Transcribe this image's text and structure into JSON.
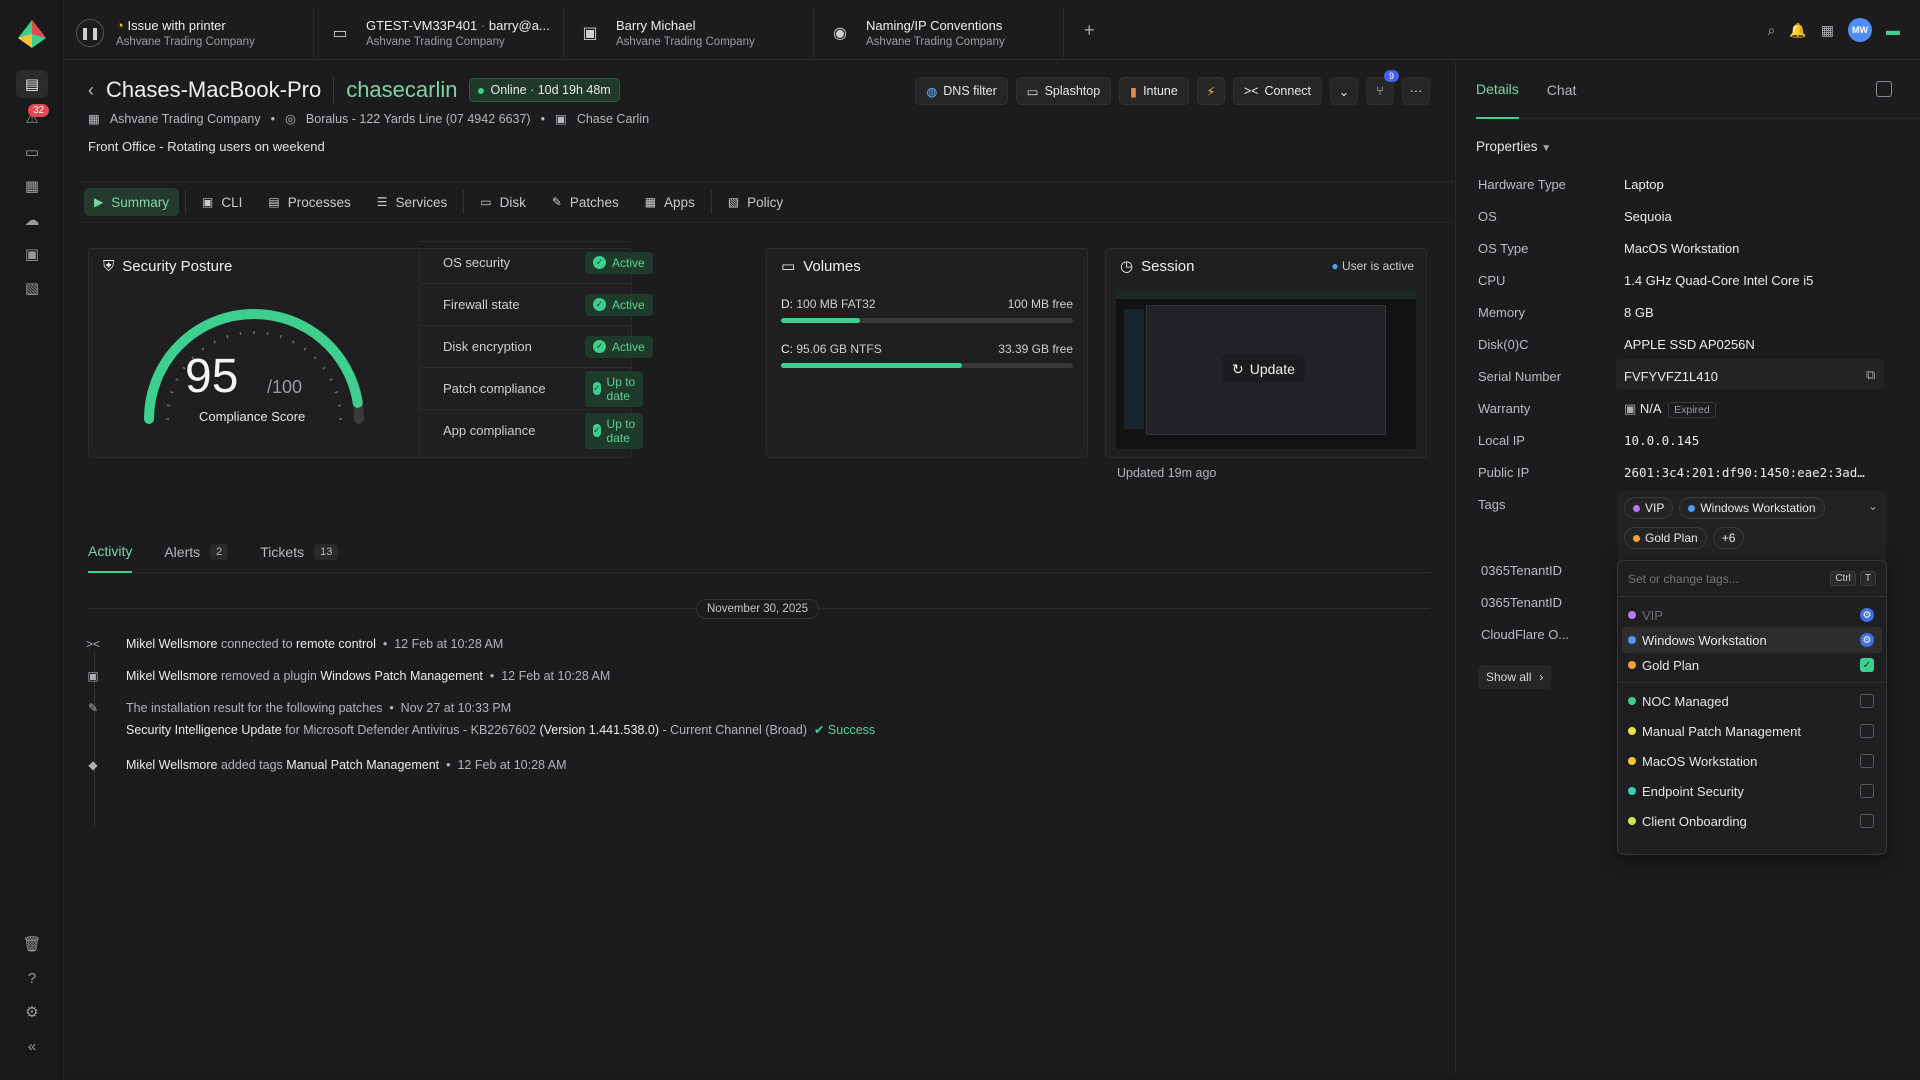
{
  "rail": {
    "badge": "32"
  },
  "top_tabs": [
    {
      "title": "Issue with printer",
      "sub": "Ashvane Trading Company"
    },
    {
      "title": "GTEST-VM33P401",
      "title2": "barry@a...",
      "sub": "Ashvane Trading Company"
    },
    {
      "title": "Barry Michael",
      "sub": "Ashvane Trading Company"
    },
    {
      "title": "Naming/IP Conventions",
      "sub": "Ashvane Trading Company"
    }
  ],
  "avatar_initials": "MW",
  "device": {
    "name": "Chases-MacBook-Pro",
    "user": "chasecarlin",
    "status": "Online",
    "uptime": "10d 19h 48m",
    "company": "Ashvane Trading Company",
    "location": "Boralus - 122 Yards Line (07 4942 6637)",
    "owner": "Chase Carlin",
    "note": "Front Office - Rotating users on weekend"
  },
  "actions": {
    "dns": "DNS filter",
    "splashtop": "Splashtop",
    "intune": "Intune",
    "connect": "Connect",
    "badge": "9"
  },
  "tabs": [
    "Summary",
    "CLI",
    "Processes",
    "Services",
    "Disk",
    "Patches",
    "Apps",
    "Policy"
  ],
  "security": {
    "title": "Security Posture",
    "score": "95",
    "max": "/100",
    "score_label": "Compliance Score",
    "score_value": 95,
    "rows": [
      {
        "label": "OS security",
        "status": "Active"
      },
      {
        "label": "Firewall state",
        "status": "Active"
      },
      {
        "label": "Disk encryption",
        "status": "Active"
      },
      {
        "label": "Patch compliance",
        "status": "Up to date"
      },
      {
        "label": "App compliance",
        "status": "Up to date"
      }
    ]
  },
  "volumes": {
    "title": "Volumes",
    "items": [
      {
        "name": "D:",
        "desc": "100 MB FAT32",
        "free": "100 MB free",
        "used_fraction": 0.27
      },
      {
        "name": "C:",
        "desc": "95.06 GB NTFS",
        "free": "33.39 GB free",
        "used_fraction": 0.62
      }
    ]
  },
  "session": {
    "title": "Session",
    "status": "User is active",
    "update": "Update",
    "updated": "Updated 19m ago"
  },
  "activity_tabs": [
    {
      "label": "Activity",
      "count": ""
    },
    {
      "label": "Alerts",
      "count": "2"
    },
    {
      "label": "Tickets",
      "count": "13"
    }
  ],
  "date": "November 30, 2025",
  "feed": {
    "r1": {
      "actor": "Mikel Wellsmore",
      "verb": "connected to",
      "obj": "remote control",
      "time": "12 Feb at 10:28 AM"
    },
    "r2": {
      "actor": "Mikel Wellsmore",
      "verb": "removed a plugin",
      "obj": "Windows Patch Management",
      "time": "12 Feb at 10:28 AM"
    },
    "r3": {
      "line1": "The installation result for the following patches",
      "time": "Nov 27 at 10:33 PM",
      "patch": "Security Intelligence Update",
      "for": "for Microsoft Defender Antivirus - KB2267602",
      "version": "(Version 1.441.538.0)",
      "channel": "- Current Channel (Broad)",
      "result": "Success"
    },
    "r4": {
      "actor": "Mikel Wellsmore",
      "verb": "added tags",
      "obj": "Manual Patch Management",
      "time": "12 Feb at 10:28 AM"
    }
  },
  "side": {
    "tabs": [
      "Details",
      "Chat"
    ],
    "properties_label": "Properties",
    "props": [
      {
        "k": "Hardware Type",
        "v": "Laptop"
      },
      {
        "k": "OS",
        "v": "Sequoia"
      },
      {
        "k": "OS Type",
        "v": "MacOS Workstation"
      },
      {
        "k": "CPU",
        "v": "1.4 GHz Quad-Core Intel Core i5"
      },
      {
        "k": "Memory",
        "v": "8 GB"
      },
      {
        "k": "Disk(0)C",
        "v": "APPLE SSD AP0256N"
      },
      {
        "k": "Serial Number",
        "v": "FVFYVFZ1L410"
      },
      {
        "k": "Warranty",
        "v": "N/A"
      },
      {
        "k": "Local IP",
        "v": "10.0.0.145"
      },
      {
        "k": "Public IP",
        "v": "2601:3c4:201:df90:1450:eae2:3ad…"
      },
      {
        "k": "Tags",
        "v": ""
      },
      {
        "k": "0365TenantID",
        "v": ""
      },
      {
        "k": "0365TenantID",
        "v": ""
      },
      {
        "k": "CloudFlare O...",
        "v": ""
      }
    ],
    "warranty_badge": "Expired",
    "tags": [
      {
        "name": "VIP",
        "color": "#b77bf0"
      },
      {
        "name": "Windows Workstation",
        "color": "#4d9cf7"
      },
      {
        "name": "Gold Plan",
        "color": "#f5a13a"
      }
    ],
    "more": "+6",
    "show_all": "Show all"
  },
  "dropdown": {
    "placeholder": "Set or change tags...",
    "ctrl": "Ctrl",
    "key": "T",
    "items": [
      {
        "name": "VIP",
        "color": "#b77bf0"
      },
      {
        "name": "Windows Workstation",
        "color": "#4d9cf7"
      },
      {
        "name": "Gold Plan",
        "color": "#f5a13a"
      },
      {
        "name": "NOC Managed",
        "color": "#3ecf8e"
      },
      {
        "name": "Manual Patch Management",
        "color": "#e6e24a"
      },
      {
        "name": "MacOS Workstation",
        "color": "#f5c23a"
      },
      {
        "name": "Endpoint Security",
        "color": "#3ecfb8"
      },
      {
        "name": "Client Onboarding",
        "color": "#c9e84a"
      }
    ]
  }
}
